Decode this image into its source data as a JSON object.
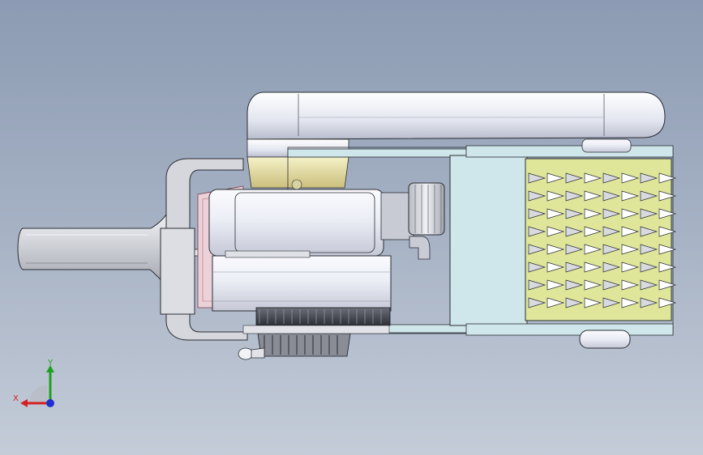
{
  "viewport": {
    "background_top": "#8c9bb3",
    "background_bottom": "#c4ccd8"
  },
  "triad": {
    "x_label": "X",
    "y_label": "Y",
    "x_color": "#d42020",
    "y_color": "#20a020",
    "z_color": "#2030d0"
  },
  "model": {
    "part_names": [
      "handle",
      "motor-housing",
      "top-cover",
      "side-frame",
      "spike-roller",
      "gear-knob",
      "base-gear",
      "cable-plug"
    ],
    "body_color": "#e8eaf2",
    "frame_color": "#cfe6ea",
    "roller_plate_color": "#dfe69a",
    "collar_color": "#e6e0a8"
  }
}
